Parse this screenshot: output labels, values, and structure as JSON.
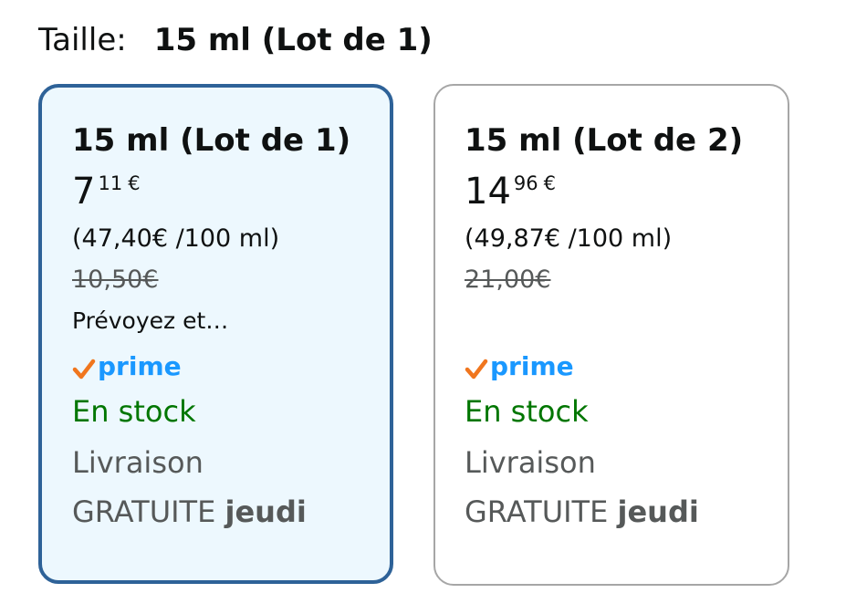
{
  "size_selector": {
    "label": "Taille:",
    "selected_value": "15 ml (Lot de 1)"
  },
  "options": [
    {
      "title": "15 ml (Lot de 1)",
      "selected": true,
      "price_whole": "7",
      "price_fraction": "11",
      "currency": "€",
      "unit_price": "(47,40€ /100 ml)",
      "list_price": "10,50€",
      "promo": "Prévoyez et…",
      "prime_label": "prime",
      "stock": "En stock",
      "delivery_line1": "Livraison",
      "delivery_line2": "GRATUITE",
      "delivery_day": "jeudi"
    },
    {
      "title": "15 ml (Lot de 2)",
      "selected": false,
      "price_whole": "14",
      "price_fraction": "96",
      "currency": "€",
      "unit_price": "(49,87€ /100 ml)",
      "list_price": "21,00€",
      "promo": "",
      "prime_label": "prime",
      "stock": "En stock",
      "delivery_line1": "Livraison",
      "delivery_line2": "GRATUITE",
      "delivery_day": "jeudi"
    }
  ],
  "colors": {
    "selected_border": "#2e6298",
    "selected_background": "#edf8fe",
    "prime_blue": "#1a98ff",
    "prime_check": "#f0761e",
    "stock_green": "#007600",
    "muted_text": "#565959"
  },
  "icons": {
    "prime_check": "checkmark-icon"
  }
}
